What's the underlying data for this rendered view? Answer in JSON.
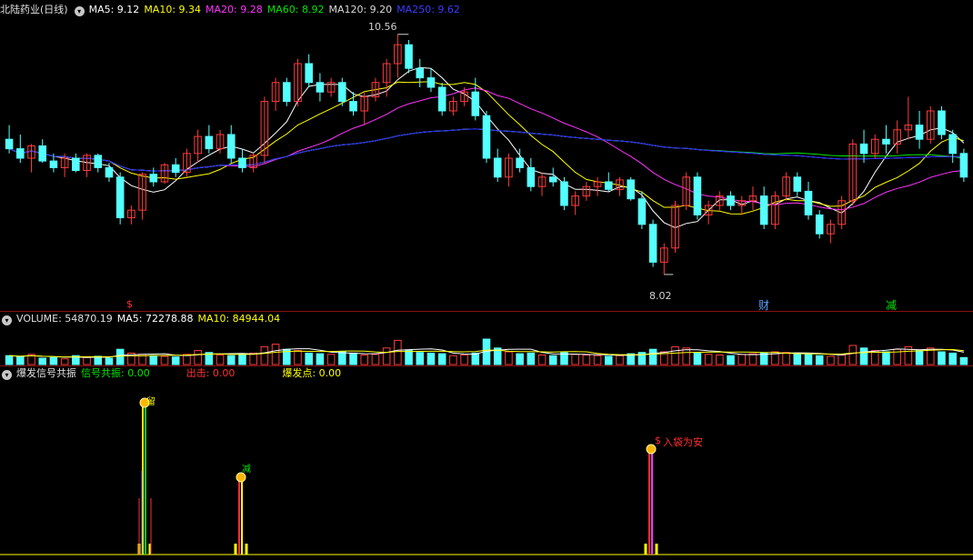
{
  "price_header": {
    "title": "北陆药业(日线)",
    "ma5": "MA5: 9.12",
    "ma10": "MA10: 9.34",
    "ma20": "MA20: 9.28",
    "ma60": "MA60: 8.92",
    "ma120": "MA120: 9.20",
    "ma250": "MA250: 9.62"
  },
  "price_annotations": {
    "high": "10.56",
    "low": "8.02",
    "marker_s": "$",
    "marker_cai": "财",
    "marker_jian": "减"
  },
  "volume_header": {
    "volume": "VOLUME: 54870.19",
    "ma5": "MA5: 72278.88",
    "ma10": "MA10: 84944.04"
  },
  "indicator_header": {
    "name": "爆发信号共振",
    "signal": "信号共振: 0.00",
    "exit": "出击: 0.00",
    "burst": "爆发点: 0.00"
  },
  "indicator_labels": {
    "label_1": "留",
    "label_2": "减",
    "label_3": "入袋为安",
    "dollar": "$"
  },
  "colors": {
    "up": "#ff3c3c",
    "down": "#54ffff",
    "ma5": "#ffffff",
    "ma10": "#ffff00",
    "ma20": "#ff33ff",
    "ma60": "#00e600",
    "ma120": "#d8d8d8",
    "ma250": "#2020ff",
    "separator": "#8a1010"
  },
  "chart_data": {
    "type": "candlestick",
    "price_range": [
      7.75,
      10.75
    ],
    "high_marker": 10.56,
    "low_marker": 8.02,
    "candles": [
      [
        9.45,
        9.6,
        9.3,
        9.35
      ],
      [
        9.35,
        9.5,
        9.2,
        9.25
      ],
      [
        9.25,
        9.4,
        9.1,
        9.38
      ],
      [
        9.38,
        9.45,
        9.2,
        9.22
      ],
      [
        9.22,
        9.3,
        9.1,
        9.15
      ],
      [
        9.15,
        9.3,
        9.05,
        9.25
      ],
      [
        9.25,
        9.3,
        9.1,
        9.12
      ],
      [
        9.12,
        9.3,
        9.05,
        9.28
      ],
      [
        9.28,
        9.3,
        9.1,
        9.15
      ],
      [
        9.15,
        9.2,
        9.0,
        9.05
      ],
      [
        9.05,
        9.1,
        8.55,
        8.62
      ],
      [
        8.62,
        8.75,
        8.55,
        8.7
      ],
      [
        8.7,
        9.1,
        8.6,
        9.08
      ],
      [
        9.08,
        9.15,
        8.95,
        9.0
      ],
      [
        9.0,
        9.2,
        8.98,
        9.18
      ],
      [
        9.18,
        9.25,
        9.05,
        9.1
      ],
      [
        9.1,
        9.35,
        9.05,
        9.3
      ],
      [
        9.3,
        9.55,
        9.2,
        9.48
      ],
      [
        9.48,
        9.6,
        9.3,
        9.35
      ],
      [
        9.35,
        9.55,
        9.3,
        9.5
      ],
      [
        9.5,
        9.6,
        9.2,
        9.25
      ],
      [
        9.25,
        9.35,
        9.1,
        9.15
      ],
      [
        9.15,
        9.3,
        9.1,
        9.28
      ],
      [
        9.28,
        9.9,
        9.2,
        9.85
      ],
      [
        9.85,
        10.1,
        9.75,
        10.05
      ],
      [
        10.05,
        10.1,
        9.8,
        9.85
      ],
      [
        9.85,
        10.3,
        9.8,
        10.25
      ],
      [
        10.25,
        10.35,
        10.0,
        10.05
      ],
      [
        10.05,
        10.15,
        9.85,
        9.95
      ],
      [
        9.95,
        10.1,
        9.9,
        10.05
      ],
      [
        10.05,
        10.1,
        9.8,
        9.85
      ],
      [
        9.85,
        9.95,
        9.7,
        9.75
      ],
      [
        9.75,
        9.95,
        9.6,
        9.9
      ],
      [
        9.9,
        10.1,
        9.85,
        10.05
      ],
      [
        10.05,
        10.3,
        9.9,
        10.25
      ],
      [
        10.25,
        10.56,
        10.1,
        10.45
      ],
      [
        10.45,
        10.5,
        10.15,
        10.2
      ],
      [
        10.2,
        10.3,
        10.0,
        10.1
      ],
      [
        10.1,
        10.2,
        9.95,
        10.0
      ],
      [
        10.0,
        10.05,
        9.7,
        9.75
      ],
      [
        9.75,
        9.9,
        9.7,
        9.85
      ],
      [
        9.85,
        10.0,
        9.8,
        9.95
      ],
      [
        9.95,
        10.1,
        9.65,
        9.7
      ],
      [
        9.7,
        9.75,
        9.2,
        9.25
      ],
      [
        9.25,
        9.35,
        9.0,
        9.05
      ],
      [
        9.05,
        9.3,
        8.95,
        9.25
      ],
      [
        9.25,
        9.35,
        9.1,
        9.15
      ],
      [
        9.15,
        9.25,
        8.9,
        8.95
      ],
      [
        8.95,
        9.1,
        8.85,
        9.05
      ],
      [
        9.05,
        9.15,
        8.95,
        9.0
      ],
      [
        9.0,
        9.05,
        8.7,
        8.75
      ],
      [
        8.75,
        8.9,
        8.65,
        8.85
      ],
      [
        8.85,
        9.0,
        8.8,
        8.95
      ],
      [
        8.95,
        9.05,
        8.85,
        9.0
      ],
      [
        9.0,
        9.1,
        8.9,
        8.92
      ],
      [
        8.92,
        9.05,
        8.85,
        9.02
      ],
      [
        9.02,
        9.05,
        8.8,
        8.82
      ],
      [
        8.82,
        8.9,
        8.5,
        8.55
      ],
      [
        8.55,
        8.6,
        8.1,
        8.15
      ],
      [
        8.15,
        8.35,
        8.02,
        8.3
      ],
      [
        8.3,
        8.8,
        8.25,
        8.75
      ],
      [
        8.75,
        9.1,
        8.7,
        9.05
      ],
      [
        9.05,
        9.1,
        8.6,
        8.65
      ],
      [
        8.65,
        8.8,
        8.55,
        8.75
      ],
      [
        8.75,
        8.9,
        8.7,
        8.85
      ],
      [
        8.85,
        8.9,
        8.7,
        8.75
      ],
      [
        8.75,
        8.85,
        8.65,
        8.8
      ],
      [
        8.8,
        8.95,
        8.7,
        8.85
      ],
      [
        8.85,
        8.95,
        8.5,
        8.55
      ],
      [
        8.55,
        8.9,
        8.5,
        8.85
      ],
      [
        8.85,
        9.1,
        8.8,
        9.05
      ],
      [
        9.05,
        9.1,
        8.85,
        8.9
      ],
      [
        8.9,
        9.0,
        8.6,
        8.65
      ],
      [
        8.65,
        8.7,
        8.4,
        8.45
      ],
      [
        8.45,
        8.6,
        8.35,
        8.55
      ],
      [
        8.55,
        8.85,
        8.5,
        8.8
      ],
      [
        8.8,
        9.45,
        8.75,
        9.4
      ],
      [
        9.4,
        9.55,
        9.2,
        9.3
      ],
      [
        9.3,
        9.5,
        9.25,
        9.45
      ],
      [
        9.45,
        9.6,
        9.3,
        9.4
      ],
      [
        9.4,
        9.65,
        9.3,
        9.55
      ],
      [
        9.55,
        9.9,
        9.45,
        9.6
      ],
      [
        9.6,
        9.75,
        9.35,
        9.45
      ],
      [
        9.45,
        9.8,
        9.4,
        9.75
      ],
      [
        9.75,
        9.8,
        9.45,
        9.5
      ],
      [
        9.5,
        9.55,
        9.2,
        9.3
      ],
      [
        9.3,
        9.35,
        9.0,
        9.05
      ]
    ],
    "volume_range": [
      0,
      300000
    ],
    "volumes": [
      70000,
      60000,
      80000,
      50000,
      55000,
      45000,
      70000,
      60000,
      65000,
      50000,
      120000,
      90000,
      80000,
      70000,
      65000,
      60000,
      80000,
      110000,
      95000,
      75000,
      70000,
      85000,
      90000,
      140000,
      160000,
      120000,
      110000,
      90000,
      85000,
      80000,
      100000,
      90000,
      75000,
      80000,
      130000,
      190000,
      110000,
      95000,
      90000,
      85000,
      70000,
      75000,
      90000,
      200000,
      130000,
      100000,
      85000,
      90000,
      75000,
      70000,
      95000,
      80000,
      75000,
      70000,
      65000,
      70000,
      85000,
      95000,
      120000,
      100000,
      140000,
      130000,
      90000,
      80000,
      75000,
      70000,
      80000,
      85000,
      90000,
      100000,
      95000,
      90000,
      80000,
      70000,
      65000,
      75000,
      150000,
      130000,
      110000,
      100000,
      120000,
      140000,
      110000,
      130000,
      100000,
      90000,
      55000
    ],
    "indicator_signals": [
      {
        "x_index": 24,
        "kind": "green_signal",
        "label": "留"
      },
      {
        "x_index": 43,
        "kind": "yellow_signal",
        "label": "减"
      },
      {
        "x_index": 118,
        "kind": "magenta_signal",
        "label": "入袋为安"
      }
    ]
  }
}
